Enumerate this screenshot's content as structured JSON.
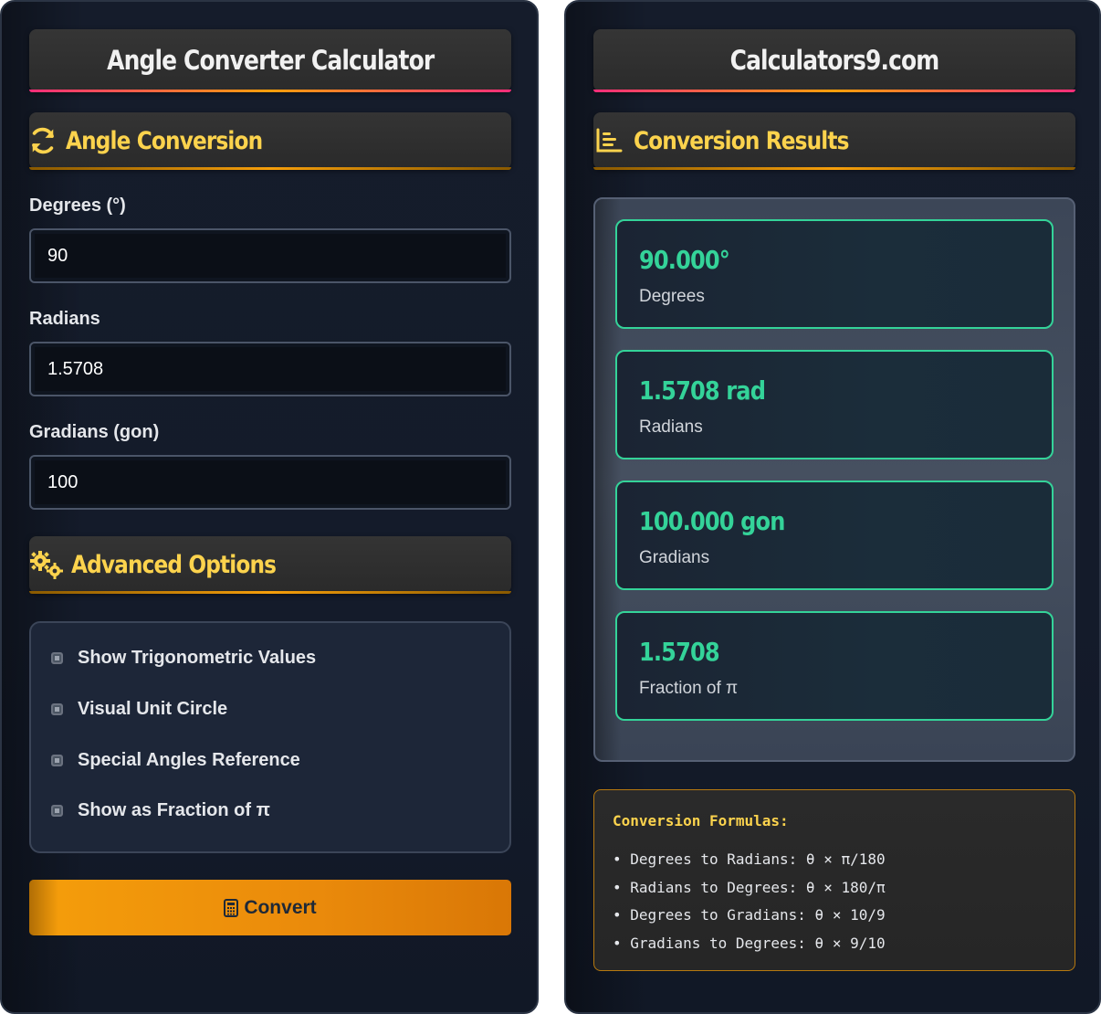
{
  "left": {
    "title": "Angle Converter Calculator",
    "conversion_section": "Angle Conversion",
    "fields": [
      {
        "label": "Degrees (°)",
        "value": "90"
      },
      {
        "label": "Radians",
        "value": "1.5708"
      },
      {
        "label": "Gradians (gon)",
        "value": "100"
      }
    ],
    "advanced_section": "Advanced Options",
    "options": [
      "Show Trigonometric Values",
      "Visual Unit Circle",
      "Special Angles Reference",
      "Show as Fraction of π"
    ],
    "convert_label": "Convert"
  },
  "right": {
    "title": "Calculators9.com",
    "results_section": "Conversion Results",
    "results": [
      {
        "value": "90.000°",
        "label": "Degrees"
      },
      {
        "value": "1.5708 rad",
        "label": "Radians"
      },
      {
        "value": "100.000 gon",
        "label": "Gradians"
      },
      {
        "value": "1.5708",
        "label": "Fraction of π"
      }
    ],
    "formulas_title": "Conversion Formulas:",
    "formulas": [
      "Degrees to Radians: θ × π/180",
      "Radians to Degrees: θ × 180/π",
      "Degrees to Gradians: θ × 10/9",
      "Gradians to Degrees: θ × 9/10"
    ]
  },
  "colors": {
    "accent_yellow": "#fcd34d",
    "accent_green": "#34d399",
    "button_orange": "#f59e0b",
    "panel_bg": "#151c2b"
  },
  "icons": {
    "conversion": "sync-icon",
    "advanced": "gears-icon",
    "results": "bar-chart-icon",
    "convert": "calculator-icon"
  }
}
